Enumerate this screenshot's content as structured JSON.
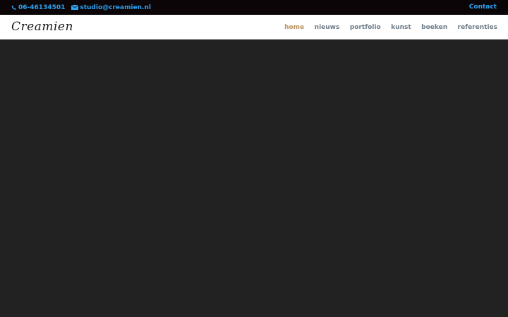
{
  "topbar": {
    "phone": "06-46134501",
    "email": "studio@creamien.nl",
    "contact_label": "Contact"
  },
  "header": {
    "logo": "Creamien"
  },
  "nav": {
    "items": [
      {
        "label": "home",
        "active": true
      },
      {
        "label": "nieuws",
        "active": false
      },
      {
        "label": "portfolio",
        "active": false
      },
      {
        "label": "kunst",
        "active": false
      },
      {
        "label": "boeken",
        "active": false
      },
      {
        "label": "referenties",
        "active": false
      }
    ]
  },
  "colors": {
    "accent": "#2ea3f2",
    "active_nav": "#b79462",
    "nav_text": "#6e7b87",
    "topbar_bg": "#0b0507",
    "hero_bg": "#222222"
  },
  "icons": {
    "phone": "phone-icon",
    "email": "envelope-icon"
  }
}
